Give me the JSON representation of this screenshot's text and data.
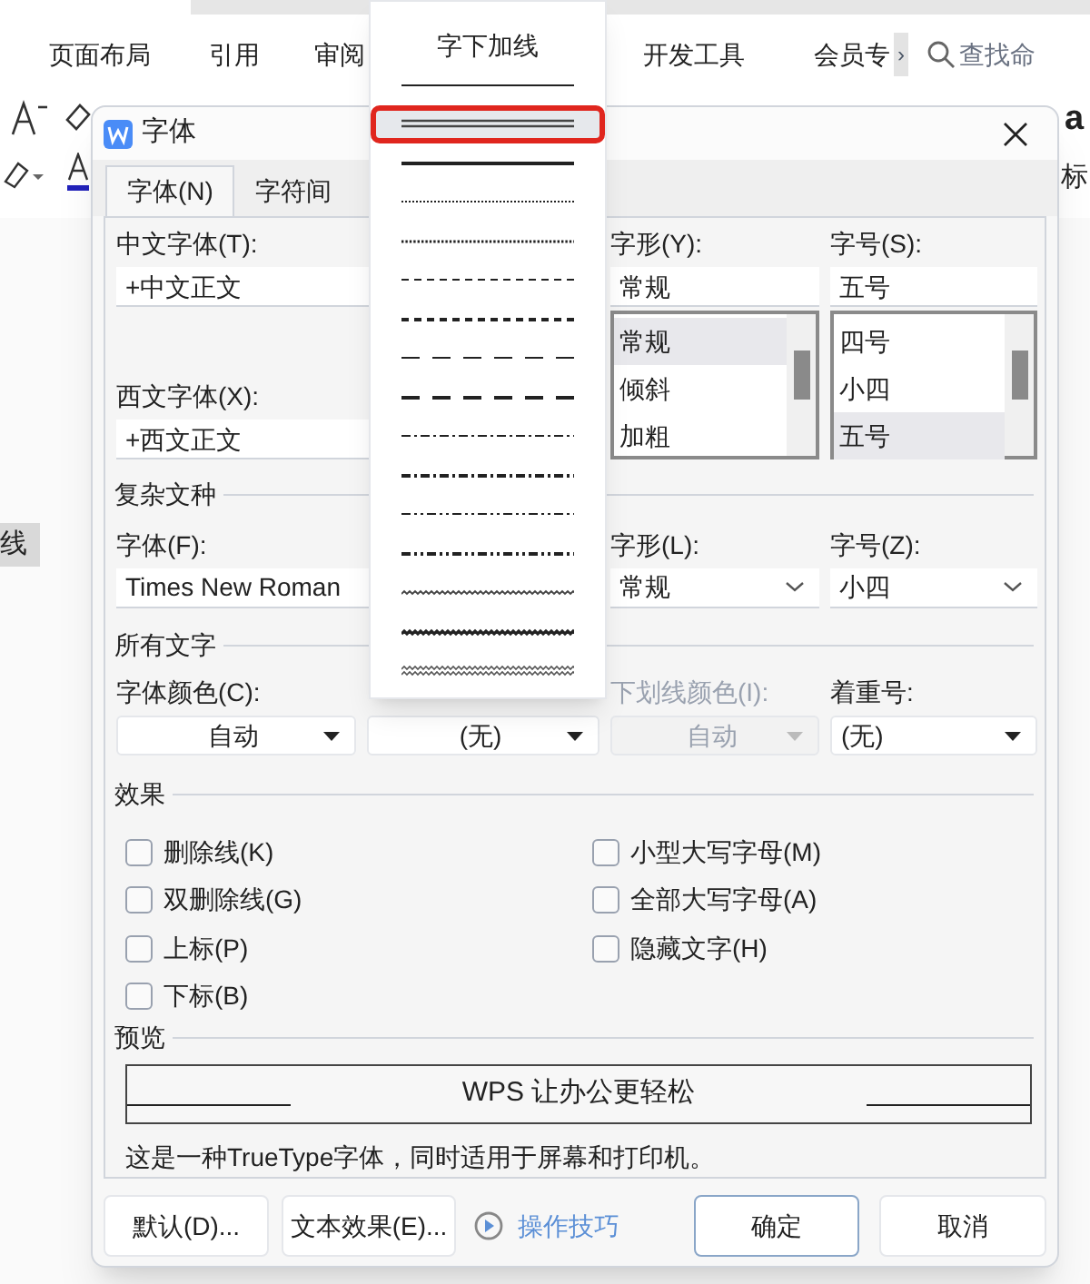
{
  "app": {
    "ribbon_tabs": [
      {
        "label": "页面布局"
      },
      {
        "label": "引用"
      },
      {
        "label": "审阅"
      },
      {
        "label": "开发工具"
      },
      {
        "label": "会员专"
      }
    ],
    "more_tabs": "›",
    "search_placeholder": "查找命",
    "style_preview": "a",
    "toolbar_text": "标",
    "document_text": "线"
  },
  "dialog": {
    "title": "字体",
    "tabs": [
      {
        "label": "字体(N)",
        "selected": true
      },
      {
        "label": "字符间",
        "selected": false
      }
    ],
    "chinese_font": {
      "label": "中文字体(T):",
      "value": "+中文正文"
    },
    "western_font": {
      "label": "西文字体(X):",
      "value": "+西文正文"
    },
    "style": {
      "label": "字形(Y):",
      "value": "常规",
      "options": [
        {
          "label": "常规",
          "selected": true
        },
        {
          "label": "倾斜",
          "selected": false
        },
        {
          "label": "加粗",
          "selected": false
        }
      ]
    },
    "size": {
      "label": "字号(S):",
      "value": "五号",
      "options": [
        {
          "label": "四号",
          "selected": false
        },
        {
          "label": "小四",
          "selected": false
        },
        {
          "label": "五号",
          "selected": true
        }
      ]
    },
    "complex_section": "复杂文种",
    "complex_fields": [
      {
        "label": "字体(F):",
        "value": "Times New Roman"
      },
      {
        "label": "字形(L):",
        "value": "常规"
      },
      {
        "label": "字号(Z):",
        "value": "小四"
      }
    ],
    "all_text_section": "所有文字",
    "all_text_fields": [
      {
        "label": "字体颜色(C):",
        "value": "自动",
        "disabled": false
      },
      {
        "value": "(无)",
        "disabled": false
      },
      {
        "label": "下划线颜色(I):",
        "value": "自动",
        "disabled": true
      },
      {
        "label": "着重号:",
        "value": "(无)",
        "disabled": false
      }
    ],
    "effects_section": "效果",
    "effects_left": [
      {
        "label": "删除线(K)",
        "checked": false
      },
      {
        "label": "双删除线(G)",
        "checked": false
      },
      {
        "label": "上标(P)",
        "checked": false
      },
      {
        "label": "下标(B)",
        "checked": false
      }
    ],
    "effects_right": [
      {
        "label": "小型大写字母(M)",
        "checked": false
      },
      {
        "label": "全部大写字母(A)",
        "checked": false
      },
      {
        "label": "隐藏文字(H)",
        "checked": false
      }
    ],
    "preview_section": "预览",
    "preview_text": "WPS 让办公更轻松",
    "info": "这是一种TrueType字体，同时适用于屏幕和打印机。",
    "buttons": [
      "默认(D)...",
      "文本效果(E)..."
    ],
    "tips_link": "操作技巧",
    "ok": "确定",
    "cancel": "取消"
  },
  "underline_menu": {
    "heading": "字下加线",
    "options": [
      {
        "kind": "single",
        "selected": false
      },
      {
        "kind": "double",
        "selected": true
      },
      {
        "kind": "thick",
        "selected": false
      },
      {
        "kind": "dotted",
        "selected": false
      },
      {
        "kind": "dotted-heavy",
        "selected": false
      },
      {
        "kind": "dash",
        "selected": false
      },
      {
        "kind": "dash-heavy",
        "selected": false
      },
      {
        "kind": "long-dash",
        "selected": false
      },
      {
        "kind": "long-dash-heavy",
        "selected": false
      },
      {
        "kind": "dash-dot",
        "selected": false
      },
      {
        "kind": "dash-dot-heavy",
        "selected": false
      },
      {
        "kind": "dash-dot-dot",
        "selected": false
      },
      {
        "kind": "dash-dot-dot-heavy",
        "selected": false
      },
      {
        "kind": "wave",
        "selected": false
      },
      {
        "kind": "wave-heavy",
        "selected": false
      },
      {
        "kind": "wave-double",
        "selected": false
      }
    ]
  }
}
